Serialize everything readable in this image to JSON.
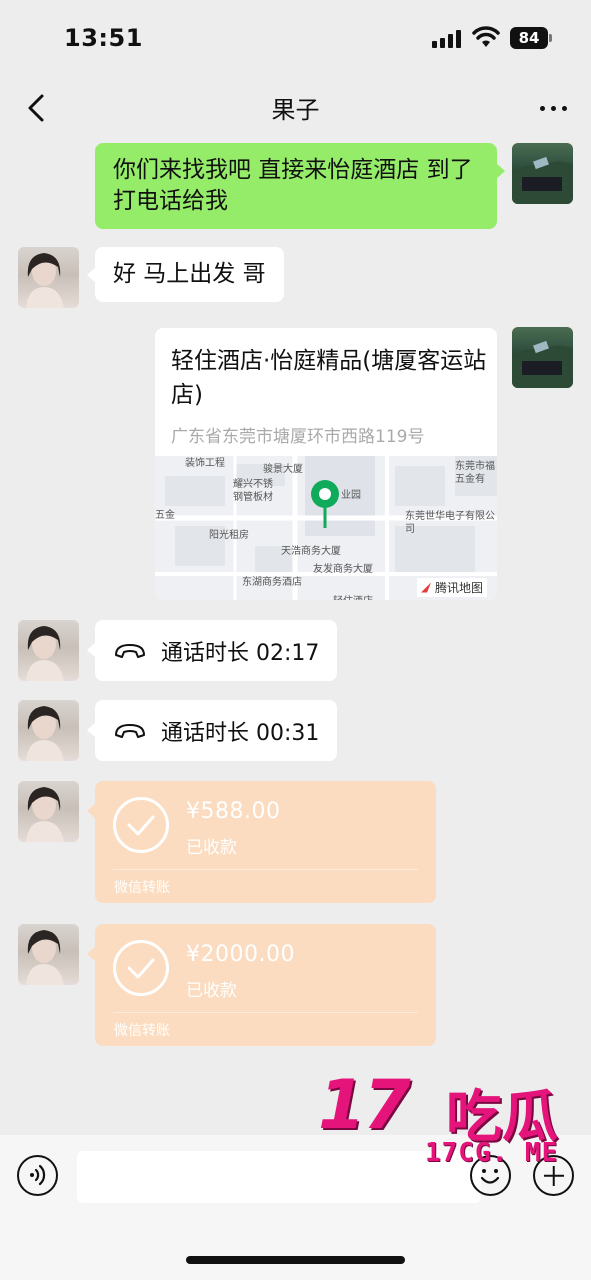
{
  "status": {
    "time": "13:51",
    "battery": "84"
  },
  "header": {
    "title": "果子"
  },
  "messages": {
    "m1": "你们来找我吧 直接来怡庭酒店 到了打电话给我",
    "m2": "好 马上出发 哥",
    "location": {
      "name": "轻住酒店·怡庭精品(塘厦客运站店)",
      "address": "广东省东莞市塘厦环市西路119号",
      "map_provider": "腾讯地图",
      "map_labels": [
        "骏景大厦",
        "耀兴不锈钢管板材",
        "阳光租房",
        "天浩商务大厦",
        "友发商务大厦",
        "东湖商务酒店",
        "东莞世华电子有限公司",
        "东莞市福五金有",
        "五金",
        "业园",
        "装饰工程",
        "轻住酒店"
      ]
    },
    "call1": {
      "label": "通话时长 02:17"
    },
    "call2": {
      "label": "通话时长 00:31"
    },
    "transfer1": {
      "amount": "¥588.00",
      "status": "已收款",
      "label": "微信转账"
    },
    "transfer2": {
      "amount": "¥2000.00",
      "status": "已收款",
      "label": "微信转账"
    }
  },
  "input": {
    "placeholder": ""
  },
  "watermark": {
    "number": "17",
    "cn": "吃瓜",
    "url": "17CG. ME"
  },
  "colors": {
    "green_bubble": "#95ec69",
    "transfer_bg": "#fbdcc0",
    "watermark": "#e4147a",
    "background": "#ededed"
  }
}
